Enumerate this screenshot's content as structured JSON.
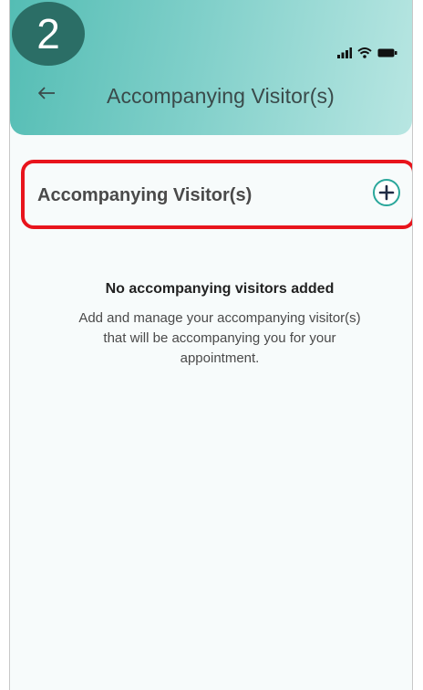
{
  "step_badge": "2",
  "header": {
    "title": "Accompanying Visitor(s)",
    "back_icon": "arrow-left-icon",
    "status_icons": [
      "signal-icon",
      "wifi-icon",
      "battery-icon"
    ]
  },
  "section": {
    "title": "Accompanying Visitor(s)",
    "add_icon": "plus-circle-icon"
  },
  "empty_state": {
    "title": "No accompanying visitors added",
    "description": "Add and manage your accompanying visitor(s) that will be accompanying you for your appointment."
  },
  "colors": {
    "accent": "#2aa79b",
    "header_gradient_start": "#54bdb4",
    "header_gradient_end": "#b8e6e2",
    "highlight": "#e8141c",
    "badge": "#2b6e66"
  }
}
